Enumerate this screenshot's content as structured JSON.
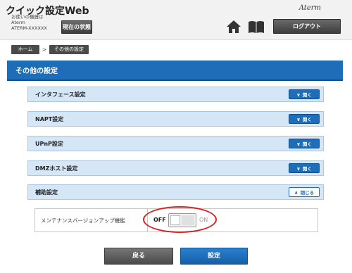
{
  "header": {
    "app_title": "クイック設定Web",
    "device_label": "お使いの機器は",
    "device_model": "Aterm",
    "device_id": "ATERM-XXXXXX",
    "status_button": "現在の状態",
    "brand": "Aterm",
    "logout_button": "ログアウト"
  },
  "breadcrumb": {
    "home": "ホーム",
    "separator": ">",
    "current": "その他の設定"
  },
  "page_title": "その他の設定",
  "sections": [
    {
      "label": "インタフェース設定",
      "button": "開く",
      "state": "collapsed"
    },
    {
      "label": "NAPT設定",
      "button": "開く",
      "state": "collapsed"
    },
    {
      "label": "UPnP設定",
      "button": "開く",
      "state": "collapsed"
    },
    {
      "label": "DMZホスト設定",
      "button": "開く",
      "state": "collapsed"
    },
    {
      "label": "補助設定",
      "button": "閉じる",
      "state": "expanded"
    }
  ],
  "setting": {
    "label": "メンテナンスバージョンアップ機能",
    "off_label": "OFF",
    "on_label": "ON",
    "value": "OFF"
  },
  "buttons": {
    "back": "戻る",
    "submit": "設定"
  },
  "colors": {
    "primary_blue": "#1e6db8",
    "section_bg": "#d5e6f6",
    "highlight_red": "#e01b1b",
    "dark_button": "#4a4a4a"
  }
}
